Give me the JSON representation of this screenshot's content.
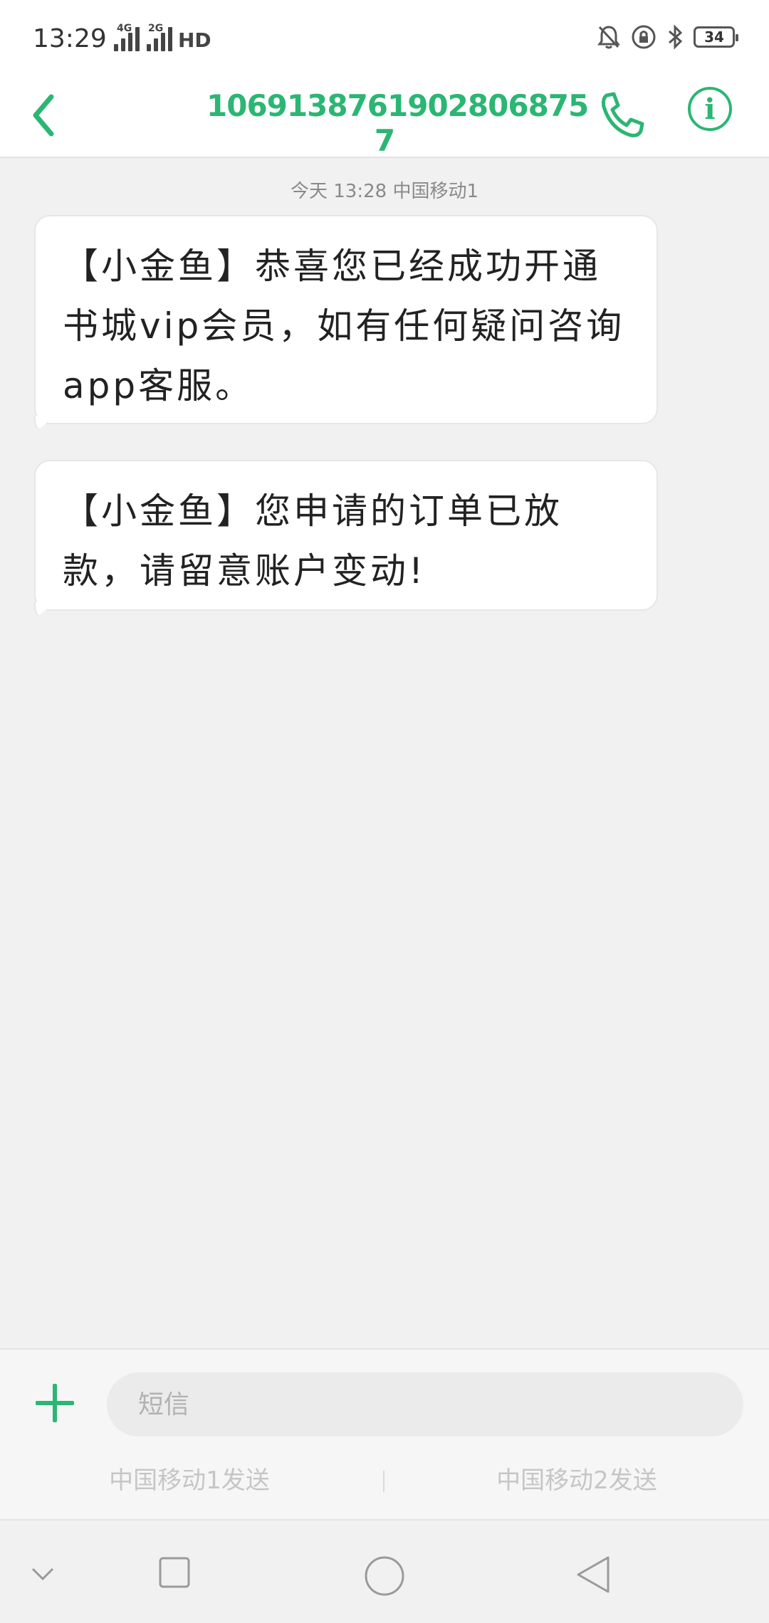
{
  "status_bar": {
    "time": "13:29",
    "sim1_network": "4G",
    "sim2_network": "2G",
    "hd_label": "HD",
    "battery_level": "34",
    "icons": [
      "mute-bell-icon",
      "lock-rotation-icon",
      "bluetooth-icon",
      "battery-icon"
    ]
  },
  "header": {
    "title": "1069138761902806875 7",
    "back_icon": "chevron-left-icon",
    "call_icon": "phone-icon",
    "info_label": "i"
  },
  "conversation": {
    "timestamp": "今天 13:28  中国移动1",
    "messages": [
      {
        "text": "【小金鱼】恭喜您已经成功开通书城vip会员，如有任何疑问咨询app客服。"
      },
      {
        "text": "【小金鱼】您申请的订单已放款，请留意账户变动!"
      }
    ]
  },
  "composer": {
    "placeholder": "短信",
    "send_sim1": "中国移动1发送",
    "send_sim2": "中国移动2发送"
  },
  "navigation": {
    "items": [
      "collapse-icon",
      "recents-icon",
      "home-icon",
      "back-icon"
    ]
  },
  "colors": {
    "accent": "#2bb673",
    "background": "#f1f1f1"
  }
}
